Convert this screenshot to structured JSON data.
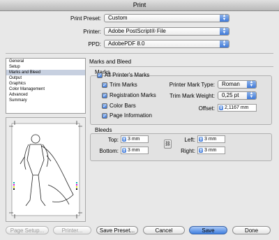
{
  "window": {
    "title": "Print"
  },
  "fields": {
    "preset": {
      "label": "Print Preset:",
      "value": "Custom"
    },
    "printer": {
      "label": "Printer:",
      "value": "Adobe PostScript® File"
    },
    "ppd": {
      "label": "PPD:",
      "value": "AdobePDF 8.0"
    }
  },
  "sidebar": {
    "items": [
      {
        "label": "General"
      },
      {
        "label": "Setup"
      },
      {
        "label": "Marks and Bleed"
      },
      {
        "label": "Output"
      },
      {
        "label": "Graphics"
      },
      {
        "label": "Color Management"
      },
      {
        "label": "Advanced"
      },
      {
        "label": "Summary"
      }
    ],
    "selected": "Marks and Bleed"
  },
  "section": {
    "title": "Marks and Bleed"
  },
  "marks": {
    "label": "Marks",
    "all_printers_marks": "All Printer's Marks",
    "trim_marks": "Trim Marks",
    "registration_marks": "Registration Marks",
    "color_bars": "Color Bars",
    "page_information": "Page Information",
    "mark_type_label": "Printer Mark Type:",
    "mark_type_value": "Roman",
    "weight_label": "Trim Mark Weight:",
    "weight_value": "0,25 pt",
    "offset_label": "Offset:",
    "offset_value": "2,1167 mm"
  },
  "bleeds": {
    "label": "Bleeds",
    "top_label": "Top:",
    "top_value": "3 mm",
    "bottom_label": "Bottom:",
    "bottom_value": "3 mm",
    "left_label": "Left:",
    "left_value": "3 mm",
    "right_label": "Right:",
    "right_value": "3 mm"
  },
  "buttons": {
    "page_setup": "Page Setup...",
    "printer": "Printer...",
    "save_preset": "Save Preset...",
    "cancel": "Cancel",
    "save": "Save",
    "done": "Done"
  }
}
